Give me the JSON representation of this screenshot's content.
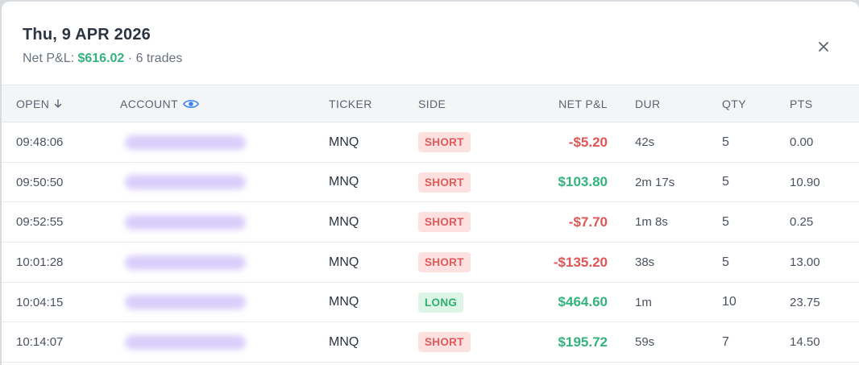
{
  "dialog": {
    "title": "Thu, 9 APR 2026",
    "net_label": "Net P&L:",
    "net_value": "$616.02",
    "separator": "·",
    "trades_count": "6 trades",
    "close_icon": "close-icon"
  },
  "columns": {
    "open": "OPEN",
    "open_sort_icon": "arrow-down-icon",
    "account": "ACCOUNT",
    "account_icon": "eye-icon",
    "ticker": "TICKER",
    "side": "SIDE",
    "net_pnl": "NET P&L",
    "dur": "DUR",
    "qty": "QTY",
    "pts": "PTS"
  },
  "colors": {
    "positive": "#34b27f",
    "negative": "#e05555",
    "short_bg": "#fde0e0",
    "long_bg": "#dcf5e7",
    "account_redaction": "#d9cdfb"
  },
  "rows": [
    {
      "open": "09:48:06",
      "ticker": "MNQ",
      "side": "SHORT",
      "pnl": "-$5.20",
      "dur": "42s",
      "qty": "5",
      "pts": "0.00"
    },
    {
      "open": "09:50:50",
      "ticker": "MNQ",
      "side": "SHORT",
      "pnl": "$103.80",
      "dur": "2m 17s",
      "qty": "5",
      "pts": "10.90"
    },
    {
      "open": "09:52:55",
      "ticker": "MNQ",
      "side": "SHORT",
      "pnl": "-$7.70",
      "dur": "1m 8s",
      "qty": "5",
      "pts": "0.25"
    },
    {
      "open": "10:01:28",
      "ticker": "MNQ",
      "side": "SHORT",
      "pnl": "-$135.20",
      "dur": "38s",
      "qty": "5",
      "pts": "13.00"
    },
    {
      "open": "10:04:15",
      "ticker": "MNQ",
      "side": "LONG",
      "pnl": "$464.60",
      "dur": "1m",
      "qty": "10",
      "pts": "23.75"
    },
    {
      "open": "10:14:07",
      "ticker": "MNQ",
      "side": "SHORT",
      "pnl": "$195.72",
      "dur": "59s",
      "qty": "7",
      "pts": "14.50"
    }
  ]
}
